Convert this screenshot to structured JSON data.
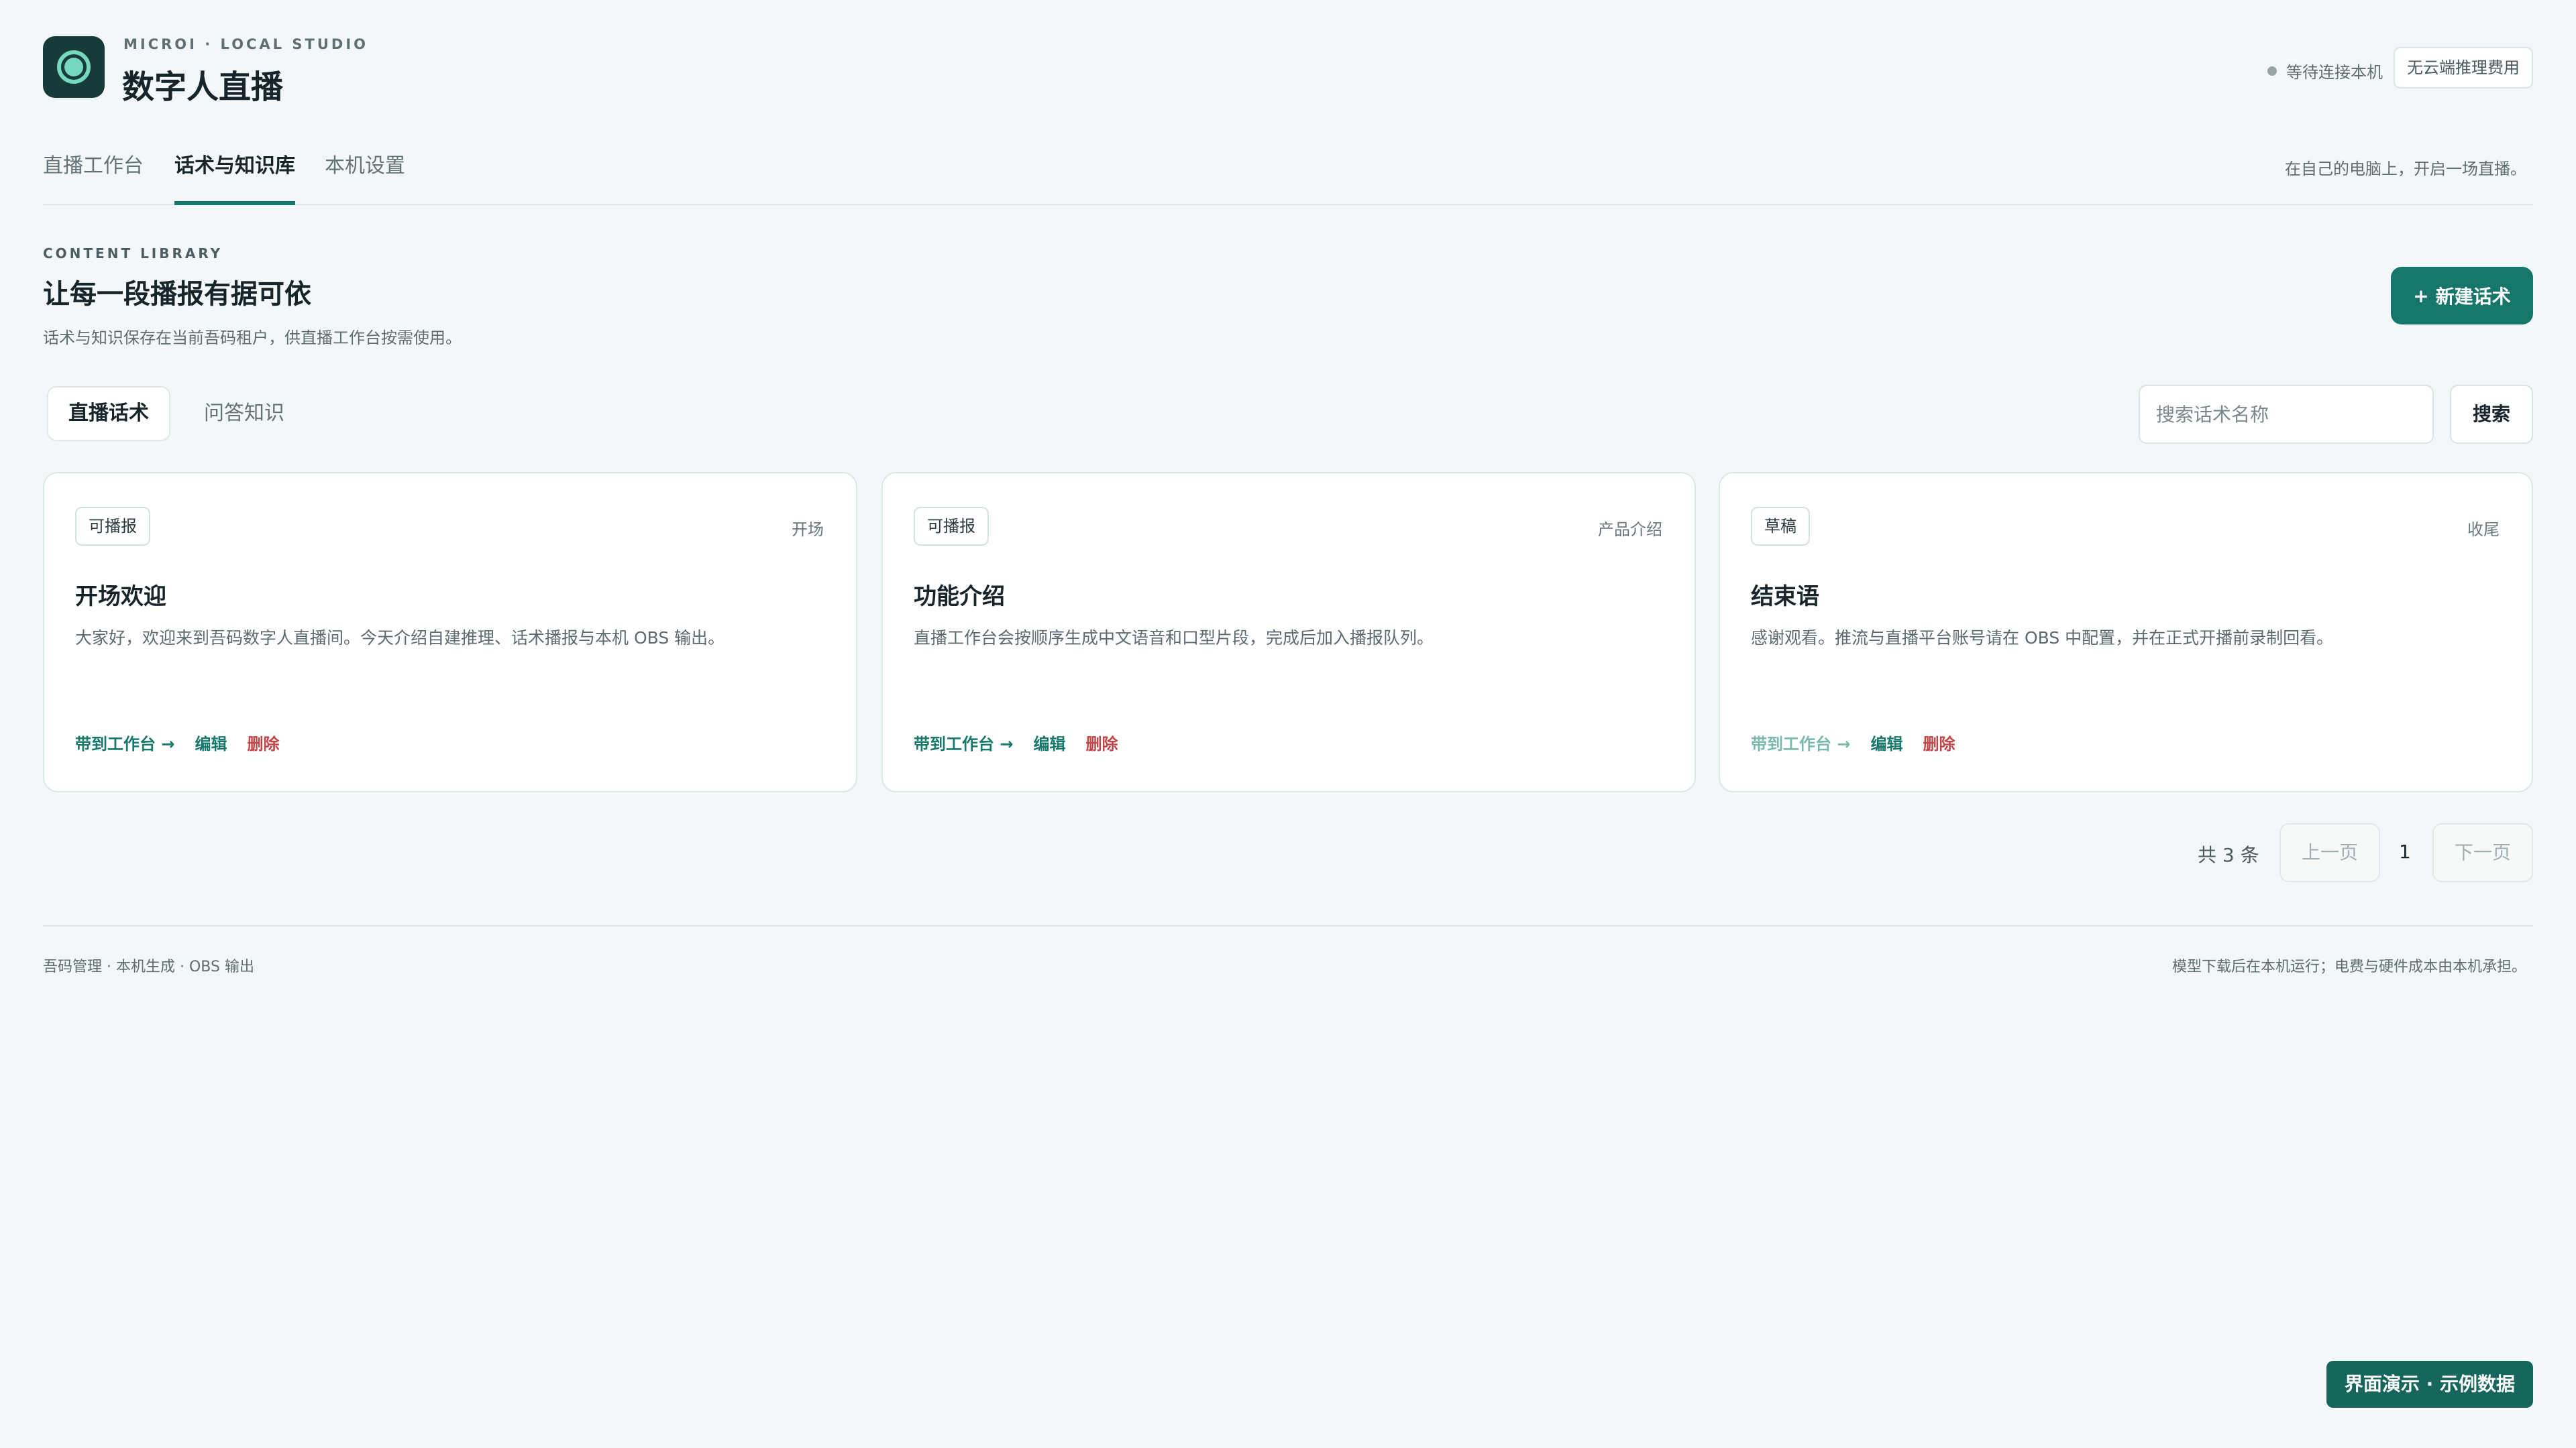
{
  "header": {
    "brand_subtitle": "MICROI · LOCAL STUDIO",
    "brand_title": "数字人直播",
    "status_text": "等待连接本机",
    "fee_badge": "无云端推理费用",
    "icon": "live-ring-icon"
  },
  "topnav": {
    "tabs": [
      {
        "label": "直播工作台",
        "active": false
      },
      {
        "label": "话术与知识库",
        "active": true
      },
      {
        "label": "本机设置",
        "active": false
      }
    ],
    "note": "在自己的电脑上，开启一场直播。"
  },
  "section": {
    "eyebrow": "CONTENT LIBRARY",
    "title": "让每一段播报有据可依",
    "description": "话术与知识保存在当前吾码租户，供直播工作台按需使用。",
    "new_button": "新建话术",
    "new_icon": "plus-icon"
  },
  "subtabs": [
    {
      "label": "直播话术",
      "active": true
    },
    {
      "label": "问答知识",
      "active": false
    }
  ],
  "search": {
    "placeholder": "搜索话术名称",
    "value": "",
    "button": "搜索"
  },
  "cards": [
    {
      "badge": "可播报",
      "category": "开场",
      "title": "开场欢迎",
      "description": "大家好，欢迎来到吾码数字人直播间。今天介绍自建推理、话术播报与本机 OBS 输出。",
      "bring": "带到工作台 →",
      "edit": "编辑",
      "delete": "删除"
    },
    {
      "badge": "可播报",
      "category": "产品介绍",
      "title": "功能介绍",
      "description": "直播工作台会按顺序生成中文语音和口型片段，完成后加入播报队列。",
      "bring": "带到工作台 →",
      "edit": "编辑",
      "delete": "删除"
    },
    {
      "badge": "草稿",
      "category": "收尾",
      "title": "结束语",
      "description": "感谢观看。推流与直播平台账号请在 OBS 中配置，并在正式开播前录制回看。",
      "bring": "带到工作台 →",
      "edit": "编辑",
      "delete": "删除"
    }
  ],
  "pagination": {
    "total": "共 3 条",
    "prev": "上一页",
    "page": "1",
    "next": "下一页"
  },
  "footer": {
    "left": "吾码管理 · 本机生成 · OBS 输出",
    "right": "模型下载后在本机运行；电费与硬件成本由本机承担。"
  },
  "demo_badge": "界面演示 · 示例数据",
  "colors": {
    "accent": "#16766a",
    "danger": "#c24548",
    "background": "#f4f7f7"
  }
}
